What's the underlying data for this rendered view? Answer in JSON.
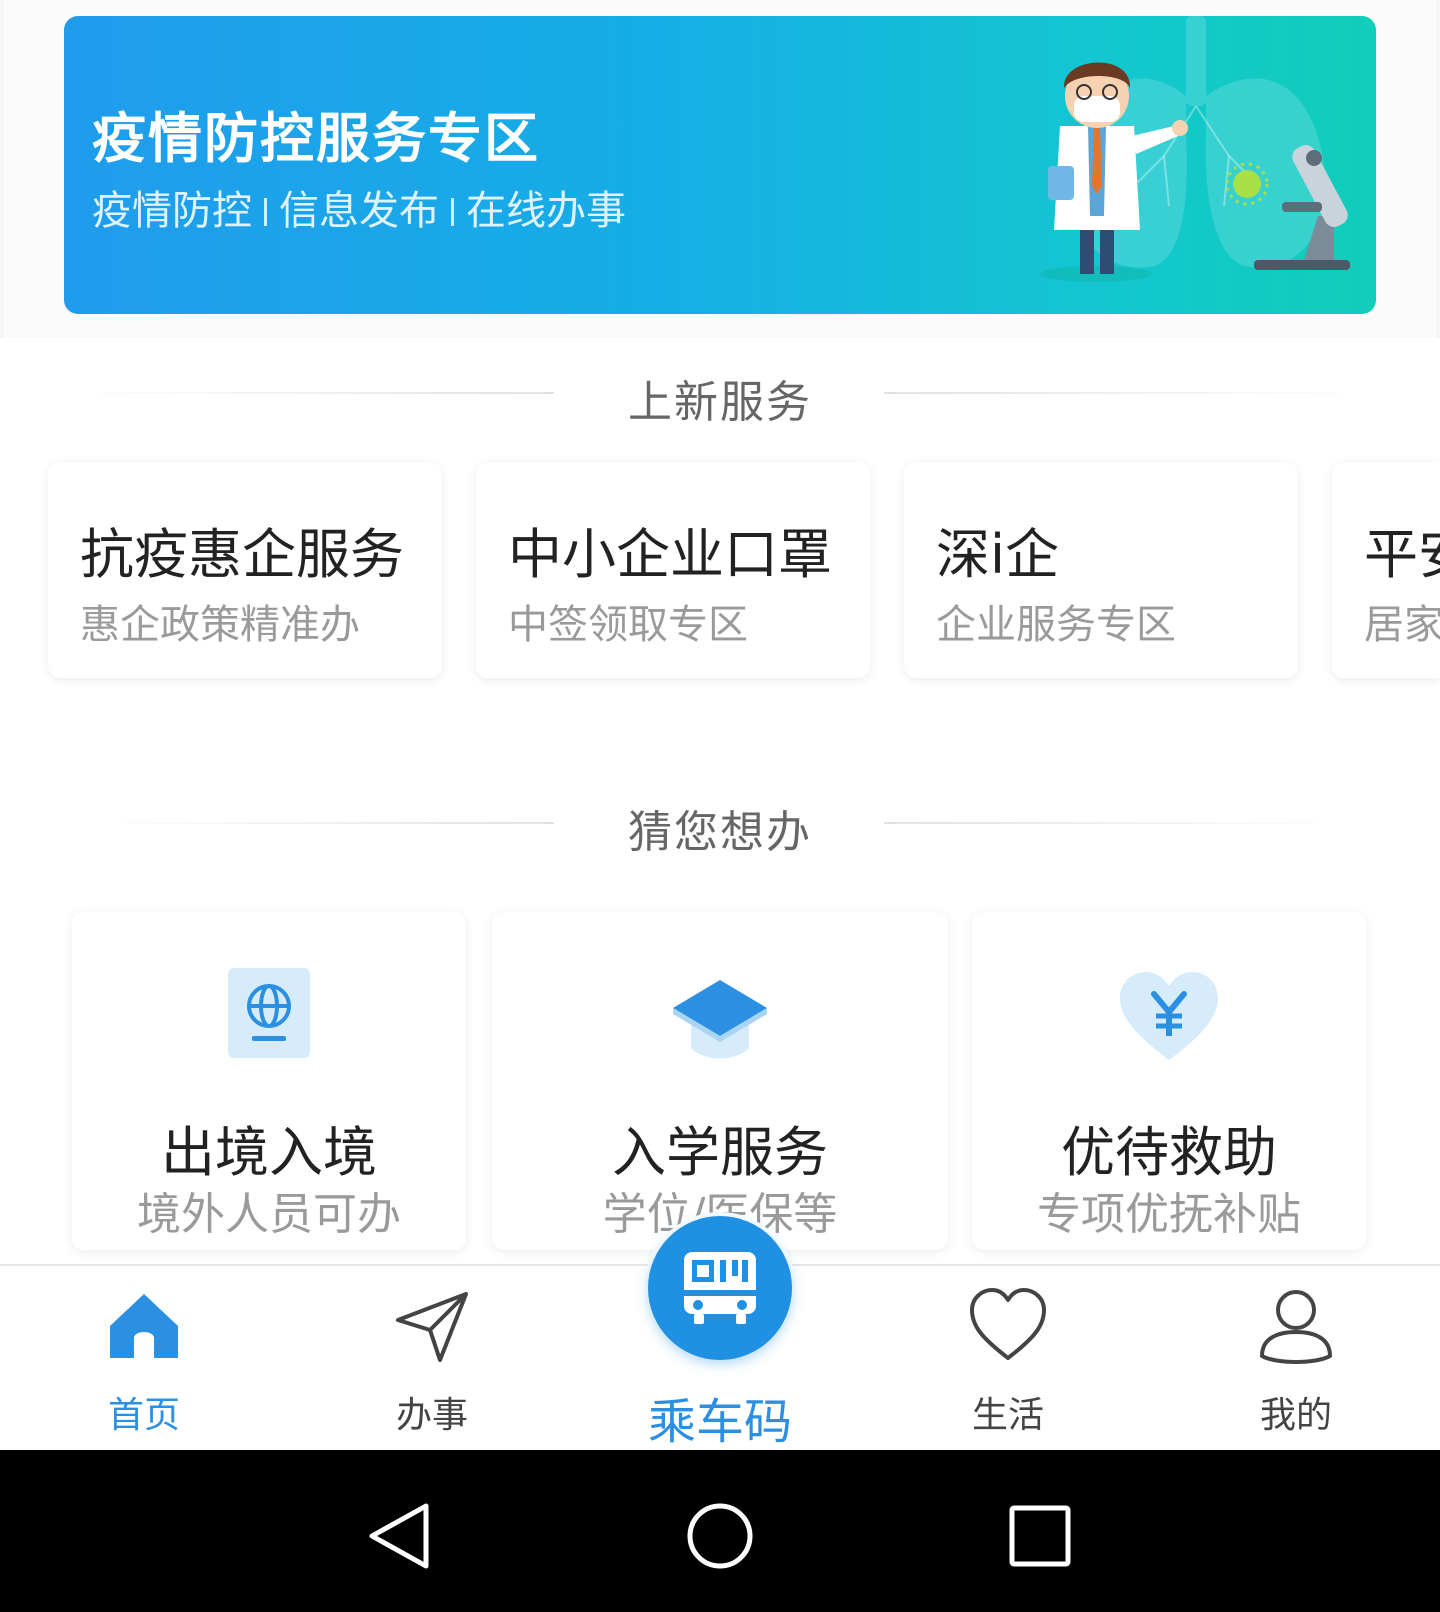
{
  "banner": {
    "title": "疫情防控服务专区",
    "subtitle_items": [
      "疫情防控",
      "信息发布",
      "在线办事"
    ]
  },
  "new_services": {
    "heading": "上新服务",
    "cards": [
      {
        "title": "抗疫惠企服务",
        "subtitle": "惠企政策精准办"
      },
      {
        "title": "中小企业口罩",
        "subtitle": "中签领取专区"
      },
      {
        "title": "深i企",
        "subtitle": "企业服务专区"
      },
      {
        "title": "平安",
        "subtitle": "居家"
      }
    ]
  },
  "guess": {
    "heading": "猜您想办",
    "cards": [
      {
        "title": "出境入境",
        "subtitle": "境外人员可办",
        "icon": "passport-globe-icon"
      },
      {
        "title": "入学服务",
        "subtitle": "学位/医保等",
        "icon": "graduation-cap-icon"
      },
      {
        "title": "优待救助",
        "subtitle": "专项优抚补贴",
        "icon": "heart-yen-icon"
      }
    ]
  },
  "tabbar": {
    "items": [
      {
        "label": "首页",
        "icon": "home-icon",
        "active": true
      },
      {
        "label": "办事",
        "icon": "send-icon",
        "active": false
      },
      {
        "label": "生活",
        "icon": "heart-icon",
        "active": false
      },
      {
        "label": "我的",
        "icon": "user-icon",
        "active": false
      }
    ],
    "center": {
      "label": "乘车码",
      "icon": "bus-qr-icon"
    }
  },
  "colors": {
    "accent": "#2b8fe2",
    "banner_start": "#1f9cec",
    "banner_end": "#12cdb9",
    "icon_light": "#d6ecfb"
  }
}
